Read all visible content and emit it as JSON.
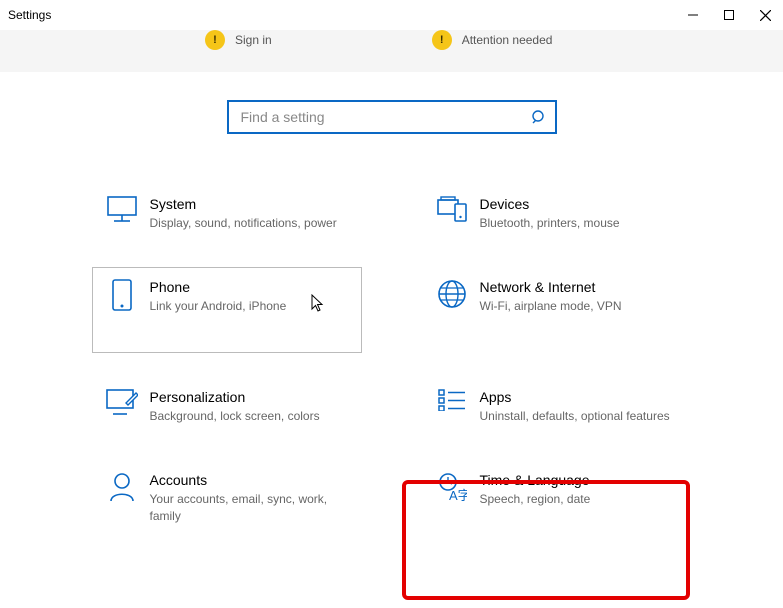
{
  "window": {
    "title": "Settings"
  },
  "topband": {
    "left_label": "Sign in",
    "right_label": "Attention needed"
  },
  "search": {
    "placeholder": "Find a setting"
  },
  "categories": {
    "system": {
      "title": "System",
      "subtitle": "Display, sound, notifications, power"
    },
    "devices": {
      "title": "Devices",
      "subtitle": "Bluetooth, printers, mouse"
    },
    "phone": {
      "title": "Phone",
      "subtitle": "Link your Android, iPhone"
    },
    "network": {
      "title": "Network & Internet",
      "subtitle": "Wi-Fi, airplane mode, VPN"
    },
    "personalization": {
      "title": "Personalization",
      "subtitle": "Background, lock screen, colors"
    },
    "apps": {
      "title": "Apps",
      "subtitle": "Uninstall, defaults, optional features"
    },
    "accounts": {
      "title": "Accounts",
      "subtitle": "Your accounts, email, sync, work, family"
    },
    "time": {
      "title": "Time & Language",
      "subtitle": "Speech, region, date"
    }
  }
}
